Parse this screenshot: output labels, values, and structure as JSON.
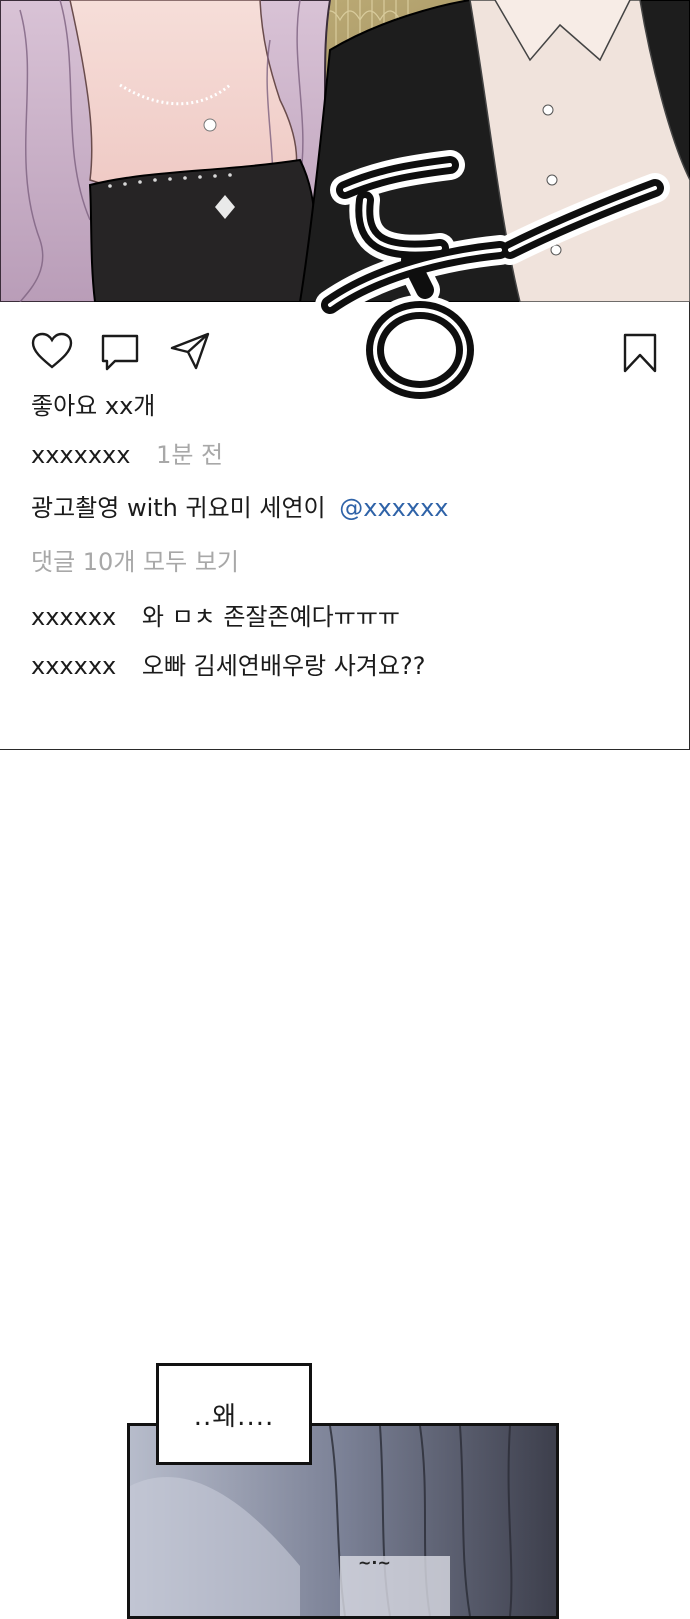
{
  "post": {
    "likes": "좋아요 xx개",
    "username": "xxxxxxx",
    "time": "1분 전",
    "caption_text": "광고촬영 with 귀요미 세연이",
    "caption_mention": "@xxxxxx",
    "view_comments": "댓글 10개 모두 보기",
    "comments": [
      {
        "user": "xxxxxx",
        "text": "와 ㅁㅊ 존잘존예다ㅠㅠㅠ"
      },
      {
        "user": "xxxxxx",
        "text": "오빠 김세연배우랑 사겨요??"
      }
    ]
  },
  "icons": {
    "like": "heart-icon",
    "comment": "comment-icon",
    "share": "send-icon",
    "save": "bookmark-icon"
  },
  "panel": {
    "speech": "..왜....",
    "sfx_small": "~·~"
  },
  "colors": {
    "mention": "#2f63a8",
    "muted": "#a8a8a8",
    "outline": "#111111"
  }
}
